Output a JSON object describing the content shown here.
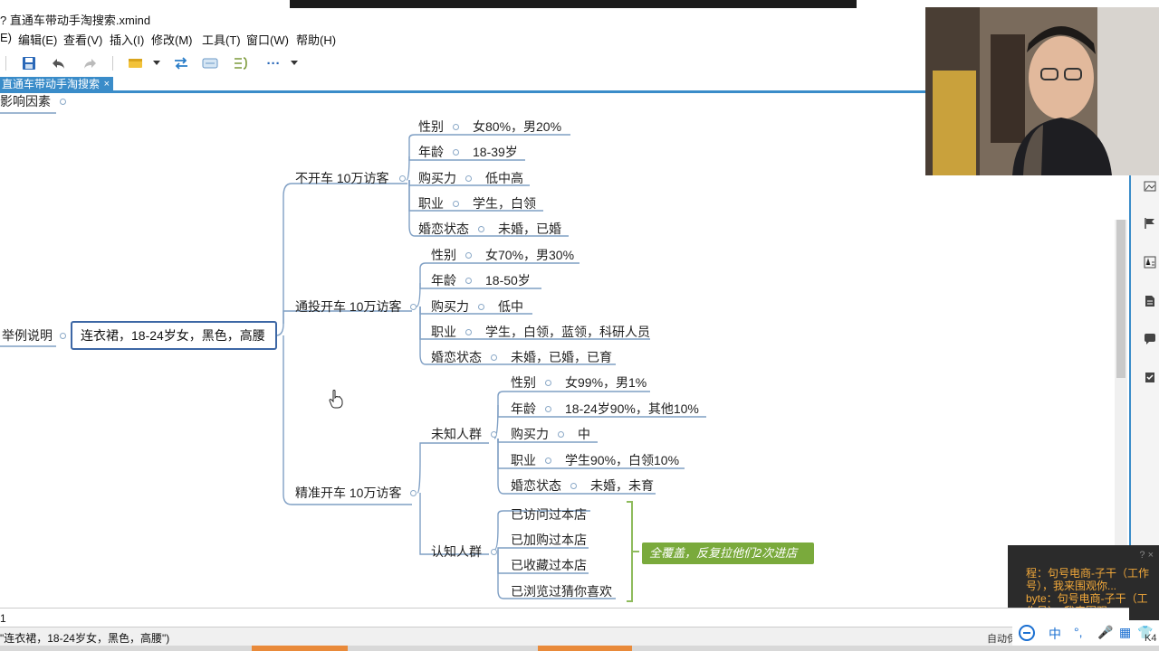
{
  "window": {
    "title": "? 直通车带动手淘搜索.xmind"
  },
  "menu": [
    {
      "label": "E)"
    },
    {
      "label": "编辑(E)"
    },
    {
      "label": "查看(V)"
    },
    {
      "label": "插入(I)"
    },
    {
      "label": "修改(M)"
    },
    {
      "label": "工具(T)"
    },
    {
      "label": "窗口(W)"
    },
    {
      "label": "帮助(H)"
    }
  ],
  "toolbar": {
    "save_icon": "floppy-disk-icon",
    "undo_icon": "undo-icon",
    "redo_icon": "redo-icon",
    "more_label": "···"
  },
  "tab": {
    "label": "直通车带动手淘搜索",
    "close": "×"
  },
  "mindmap": {
    "left_partial_topic": "影响因素",
    "parent_topic": "举例说明",
    "central_topic": "连衣裙，18-24岁女，黑色，高腰",
    "branches": [
      {
        "label": "不开车 10万访客",
        "attributes": [
          {
            "key": "性别",
            "value": "女80%，男20%"
          },
          {
            "key": "年龄",
            "value": "18-39岁"
          },
          {
            "key": "购买力",
            "value": "低中高"
          },
          {
            "key": "职业",
            "value": "学生，白领"
          },
          {
            "key": "婚恋状态",
            "value": "未婚，已婚"
          }
        ]
      },
      {
        "label": "通投开车 10万访客",
        "attributes": [
          {
            "key": "性别",
            "value": "女70%，男30%"
          },
          {
            "key": "年龄",
            "value": "18-50岁"
          },
          {
            "key": "购买力",
            "value": "低中"
          },
          {
            "key": "职业",
            "value": "学生，白领，蓝领，科研人员"
          },
          {
            "key": "婚恋状态",
            "value": "未婚，已婚，已育"
          }
        ]
      },
      {
        "label": "精准开车 10万访客",
        "groups": [
          {
            "label": "未知人群",
            "attributes": [
              {
                "key": "性别",
                "value": "女99%，男1%"
              },
              {
                "key": "年龄",
                "value": "18-24岁90%，其他10%"
              },
              {
                "key": "购买力",
                "value": "中"
              },
              {
                "key": "职业",
                "value": "学生90%，白领10%"
              },
              {
                "key": "婚恋状态",
                "value": "未婚，未育"
              }
            ]
          },
          {
            "label": "认知人群",
            "items": [
              "已访问过本店",
              "已加购过本店",
              "已收藏过本店",
              "已浏览过猜你喜欢"
            ],
            "summary": "全覆盖，反复拉他们2次进店"
          }
        ]
      }
    ]
  },
  "chat": {
    "lines": [
      "程：句号电商-子干（工作号），我来围观你...",
      "byte：句号电商-子干（工作号），我来围观..."
    ]
  },
  "command_line": {
    "value": "1"
  },
  "status": {
    "selection": "\"连衣裙，18-24岁女，黑色，高腰\")",
    "autosave": "自动保"
  },
  "ime": {
    "lang": "中",
    "items": [
      "°,",
      "🎤",
      "▦",
      "👕"
    ]
  },
  "misc": {
    "corner_label": "K4"
  },
  "colors": {
    "accent": "#3a8cc9",
    "central_border": "#3d67a5",
    "summary_bg": "#7aaa3c",
    "branch_line": "#7f9fc4",
    "chat_text": "#f3a93a"
  }
}
